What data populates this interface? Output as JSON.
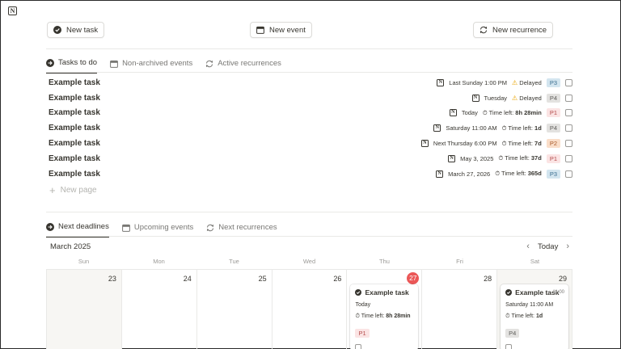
{
  "app": {
    "logo_icon": "notion-logo-icon"
  },
  "toolbar": {
    "new_task": "New task",
    "new_event": "New event",
    "new_recurrence": "New recurrence"
  },
  "top_tabs": [
    {
      "label": "Tasks to do",
      "icon": "arrow-circle-icon"
    },
    {
      "label": "Non-archived events",
      "icon": "calendar-icon"
    },
    {
      "label": "Active recurrences",
      "icon": "repeat-icon"
    }
  ],
  "tasks": [
    {
      "title": "Example task",
      "date": "Last Sunday 1:00 PM",
      "status": "Delayed",
      "time_left_label": "",
      "time_left": "",
      "priority": "P3"
    },
    {
      "title": "Example task",
      "date": "Tuesday",
      "status": "Delayed",
      "time_left_label": "",
      "time_left": "",
      "priority": "P4"
    },
    {
      "title": "Example task",
      "date": "Today",
      "status": "",
      "time_left_label": "Time left:",
      "time_left": "8h 28min",
      "priority": "P1"
    },
    {
      "title": "Example task",
      "date": "Saturday 11:00 AM",
      "status": "",
      "time_left_label": "Time left:",
      "time_left": "1d",
      "priority": "P4"
    },
    {
      "title": "Example task",
      "date": "Next Thursday 6:00 PM",
      "status": "",
      "time_left_label": "Time left:",
      "time_left": "7d",
      "priority": "P2"
    },
    {
      "title": "Example task",
      "date": "May 3, 2025",
      "status": "",
      "time_left_label": "Time left:",
      "time_left": "37d",
      "priority": "P1"
    },
    {
      "title": "Example task",
      "date": "March 27, 2026",
      "status": "",
      "time_left_label": "Time left:",
      "time_left": "365d",
      "priority": "P3"
    }
  ],
  "new_page": "New page",
  "bottom_tabs": [
    {
      "label": "Next deadlines",
      "icon": "arrow-circle-icon"
    },
    {
      "label": "Upcoming events",
      "icon": "calendar-icon"
    },
    {
      "label": "Next recurrences",
      "icon": "repeat-icon"
    }
  ],
  "calendar": {
    "month": "March 2025",
    "today_label": "Today",
    "weekdays": [
      "Sun",
      "Mon",
      "Tue",
      "Wed",
      "Thu",
      "Fri",
      "Sat"
    ],
    "days": [
      "23",
      "24",
      "25",
      "26",
      "27",
      "28",
      "29"
    ],
    "today_index": 4,
    "cards": [
      {
        "day_index": 4,
        "title": "Example task",
        "time": "",
        "date": "Today",
        "time_left_label": "Time left:",
        "time_left": "8h 28min",
        "priority": "P1"
      },
      {
        "day_index": 6,
        "title": "Example task",
        "time": "11:00",
        "date": "Saturday 11:00 AM",
        "time_left_label": "Time left:",
        "time_left": "1d",
        "priority": "P4"
      }
    ]
  },
  "priority_colors": {
    "P1": {
      "bg": "#fbe4e4",
      "fg": "#b34b4b"
    },
    "P2": {
      "bg": "#fadec9",
      "fg": "#a85a2a"
    },
    "P3": {
      "bg": "#d3e5ef",
      "fg": "#3c6e8f"
    },
    "P4": {
      "bg": "#e3e2e0",
      "fg": "#5f5e5b"
    }
  }
}
